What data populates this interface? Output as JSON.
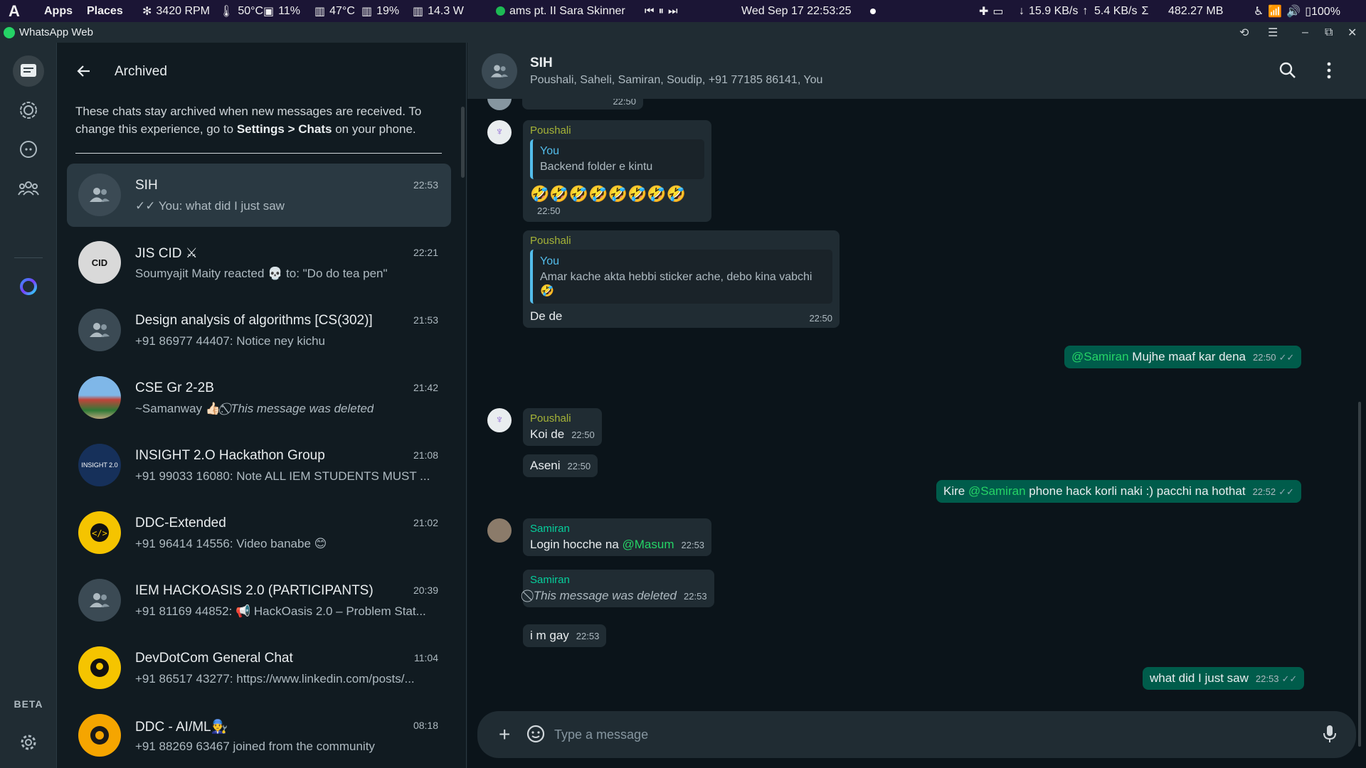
{
  "topbar": {
    "logo": "A",
    "apps": "Apps",
    "places": "Places",
    "fan_rpm": "3420 RPM",
    "cpu_temp": "50°C",
    "cpu_usage": "11%",
    "gpu_temp": "47°C",
    "gpu_usage": "19%",
    "power": "14.3 W",
    "media_title": "ams pt. II Sara Skinner",
    "clock": "Wed Sep 17  22:53:25",
    "net_down": "15.9 KB/s",
    "net_up": "5.4 KB/s",
    "memory": "482.27 MB",
    "battery": "100%"
  },
  "window": {
    "title": "WhatsApp Web"
  },
  "rail": {
    "beta_label": "BETA"
  },
  "list_panel": {
    "title": "Archived",
    "info_text_1": "These chats stay archived when new messages are received. To change this experience, go to ",
    "info_bold": "Settings > Chats",
    "info_text_2": " on your phone.",
    "chats": [
      {
        "name": "SIH",
        "time": "22:53",
        "preview": "✓✓ You: what did I just saw"
      },
      {
        "name": "JIS CID ⚔",
        "time": "22:21",
        "preview": "Soumyajit Maity reacted 💀 to: \"Do do tea pen\""
      },
      {
        "name": "Design analysis of algorithms [CS(302)]",
        "time": "21:53",
        "preview": "+91 86977 44407: Notice ney kichu"
      },
      {
        "name": "CSE Gr 2-2B",
        "time": "21:42",
        "preview_prefix": "~Samanway 👍🏻: ",
        "preview_deleted": "⃠ This message was deleted"
      },
      {
        "name": "INSIGHT 2.O Hackathon Group",
        "time": "21:08",
        "preview": "+91 99033 16080: Note ALL IEM STUDENTS MUST ..."
      },
      {
        "name": "DDC-Extended",
        "time": "21:02",
        "preview": "+91 96414 14556: Video banabe 😊"
      },
      {
        "name": "IEM HACKOASIS 2.0 (PARTICIPANTS)",
        "time": "20:39",
        "preview": "+91 81169 44852: 📢 HackOasis 2.0 – Problem Stat..."
      },
      {
        "name": "DevDotCom General Chat",
        "time": "11:04",
        "preview": "+91 86517 43277: https://www.linkedin.com/posts/..."
      },
      {
        "name": "DDC - AI/ML👨‍🔧",
        "time": "08:18",
        "preview": "+91 88269 63467 joined from the community"
      }
    ]
  },
  "conversation": {
    "name": "SIH",
    "members": "Poushali, Saheli, Samiran, Soudip, +91 77185 86141, You",
    "top_cut_time": "22:50",
    "m1": {
      "sender": "Poushali",
      "quote_name": "You",
      "quote_text": "Backend folder e kintu",
      "body": "🤣🤣🤣🤣🤣🤣🤣🤣",
      "time": "22:50"
    },
    "m2": {
      "sender": "Poushali",
      "quote_name": "You",
      "quote_text": "Amar kache akta hebbi sticker ache, debo kina vabchi 🤣",
      "body": "De de",
      "time": "22:50"
    },
    "m3": {
      "mention": "@Samiran",
      "body": " Mujhe maaf kar dena",
      "time": "22:50",
      "ticks": "✓✓"
    },
    "m4": {
      "sender": "Poushali",
      "body": "Koi de",
      "time": "22:50"
    },
    "m5": {
      "body": "Aseni",
      "time": "22:50"
    },
    "m6": {
      "pre": "Kire ",
      "mention": "@Samiran",
      "body": " phone hack korli naki :) pacchi na hothat",
      "time": "22:52",
      "ticks": "✓✓"
    },
    "m7": {
      "sender": "Samiran",
      "body": "Login hocche na ",
      "mention": "@Masum",
      "time": "22:53"
    },
    "m8": {
      "sender": "Samiran",
      "body": "This message was deleted",
      "time": "22:53"
    },
    "m9": {
      "body": "i m gay",
      "time": "22:53"
    },
    "m10": {
      "body": "what did I just saw",
      "time": "22:53",
      "ticks": "✓✓"
    },
    "composer_placeholder": "Type a message"
  }
}
